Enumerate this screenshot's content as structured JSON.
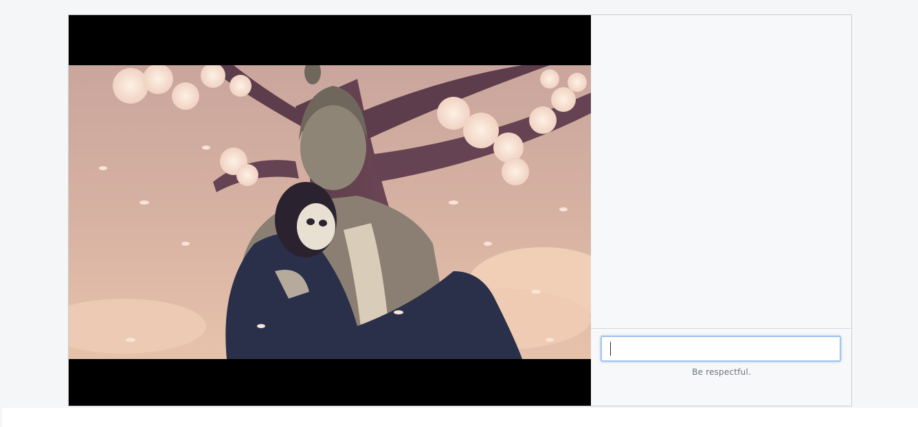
{
  "chat": {
    "input_value": "",
    "input_placeholder": "",
    "note": "Be respectful."
  },
  "video": {
    "content": "illustrated-video-frame"
  },
  "colors": {
    "input_focus_border": "#9ec3ef",
    "video_background": "#000000",
    "chat_background": "#f7f8fa"
  }
}
